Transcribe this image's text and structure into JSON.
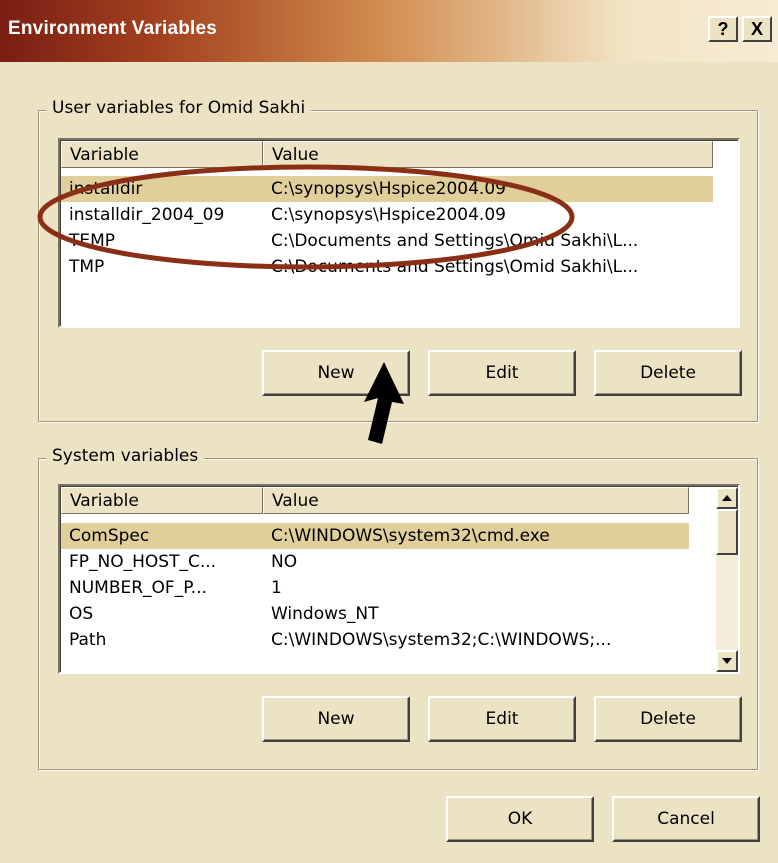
{
  "window": {
    "title": "Environment Variables",
    "help_glyph": "?",
    "close_glyph": "X"
  },
  "user_section": {
    "label": "User variables for Omid Sakhi",
    "columns": [
      "Variable",
      "Value"
    ],
    "rows": [
      {
        "variable": "installdir",
        "value": "C:\\synopsys\\Hspice2004.09",
        "selected": true
      },
      {
        "variable": "installdir_2004_09",
        "value": "C:\\synopsys\\Hspice2004.09",
        "selected": false
      },
      {
        "variable": "TEMP",
        "value": "C:\\Documents and Settings\\Omid Sakhi\\L...",
        "selected": false
      },
      {
        "variable": "TMP",
        "value": "C:\\Documents and Settings\\Omid Sakhi\\L...",
        "selected": false
      }
    ],
    "buttons": {
      "new": "New",
      "edit": "Edit",
      "delete": "Delete"
    }
  },
  "system_section": {
    "label": "System variables",
    "columns": [
      "Variable",
      "Value"
    ],
    "rows": [
      {
        "variable": "ComSpec",
        "value": "C:\\WINDOWS\\system32\\cmd.exe",
        "selected": true
      },
      {
        "variable": "FP_NO_HOST_C...",
        "value": "NO",
        "selected": false
      },
      {
        "variable": "NUMBER_OF_P...",
        "value": "1",
        "selected": false
      },
      {
        "variable": "OS",
        "value": "Windows_NT",
        "selected": false
      },
      {
        "variable": "Path",
        "value": "C:\\WINDOWS\\system32;C:\\WINDOWS;...",
        "selected": false
      }
    ],
    "buttons": {
      "new": "New",
      "edit": "Edit",
      "delete": "Delete"
    }
  },
  "footer": {
    "ok": "OK",
    "cancel": "Cancel"
  },
  "colors": {
    "dialog_bg": "#ece3c4",
    "selection": "#e0cf9a",
    "annotation_ellipse": "#8b2e16",
    "annotation_arrow": "#000000"
  },
  "icons": {
    "scroll_up": "scroll-up-arrow-icon",
    "scroll_down": "scroll-down-arrow-icon",
    "annotation_arrow": "pointer-arrow-icon"
  }
}
